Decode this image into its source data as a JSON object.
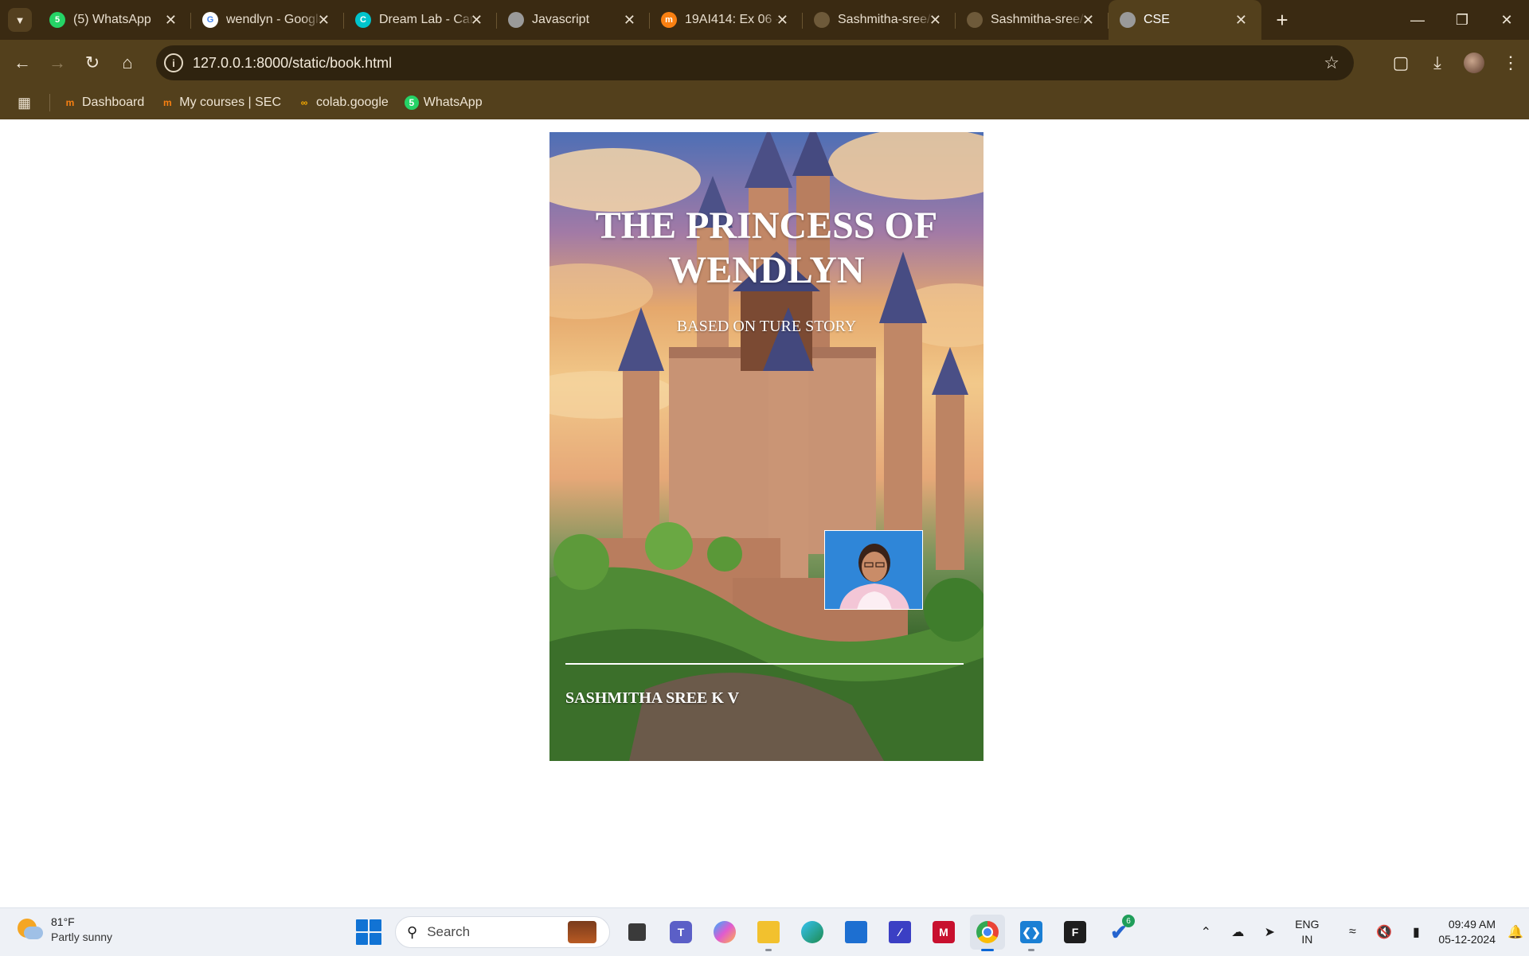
{
  "browser": {
    "tabs": [
      {
        "title": "(5) WhatsApp",
        "favicon": "whatsapp-icon",
        "color": "#25d366",
        "glyph": "5"
      },
      {
        "title": "wendlyn - Google Search",
        "favicon": "google-icon",
        "color": "#ffffff",
        "glyph": "G"
      },
      {
        "title": "Dream Lab - Canva",
        "favicon": "canva-icon",
        "color": "#00c4cc",
        "glyph": "C"
      },
      {
        "title": "Javascript",
        "favicon": "globe-icon",
        "color": "#9a9a9a",
        "glyph": ""
      },
      {
        "title": "19AI414: Ex 06 -",
        "favicon": "moodle-icon",
        "color": "#f98012",
        "glyph": "m"
      },
      {
        "title": "Sashmitha-sree/",
        "favicon": "github-icon",
        "color": "#6e5a3a",
        "glyph": ""
      },
      {
        "title": "Sashmitha-sree/",
        "favicon": "github-icon",
        "color": "#6e5a3a",
        "glyph": ""
      },
      {
        "title": "CSE",
        "favicon": "globe-icon",
        "color": "#9a9a9a",
        "glyph": "",
        "active": true
      }
    ],
    "new_tab_label": "+",
    "url": "127.0.0.1:8000/static/book.html",
    "bookmarks": [
      {
        "label": "Dashboard",
        "icon": "moodle-icon"
      },
      {
        "label": "My courses | SEC",
        "icon": "moodle-icon"
      },
      {
        "label": "colab.google",
        "icon": "colab-icon"
      },
      {
        "label": "WhatsApp",
        "icon": "whatsapp-icon"
      }
    ]
  },
  "cover": {
    "title": "THE PRINCESS OF WENDLYN",
    "subtitle": "BASED ON TURE STORY",
    "author": "SASHMITHA SREE K V"
  },
  "taskbar": {
    "weather_temp": "81°F",
    "weather_desc": "Partly sunny",
    "search_placeholder": "Search",
    "todo_badge": "6",
    "lang_line1": "ENG",
    "lang_line2": "IN",
    "time": "09:49 AM",
    "date": "05-12-2024"
  }
}
